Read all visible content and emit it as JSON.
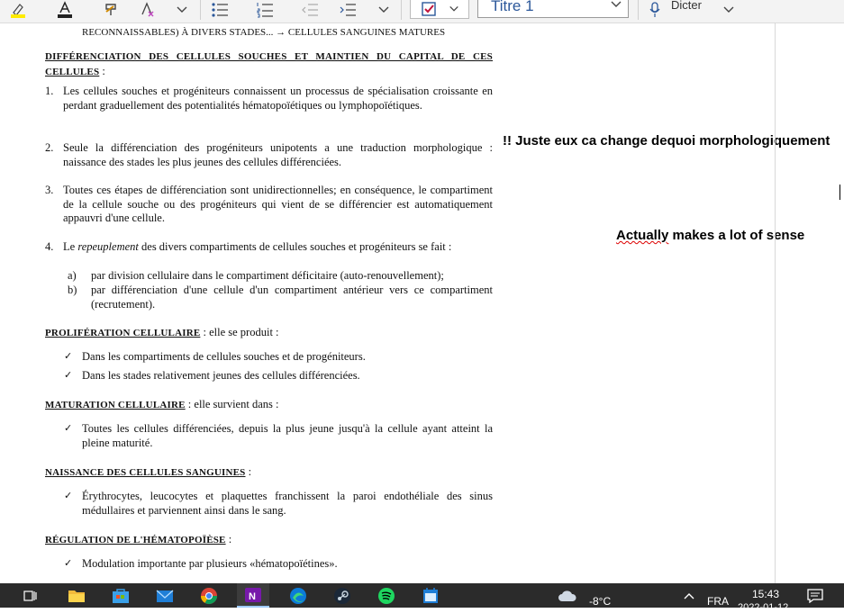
{
  "ribbon": {
    "style_value": "Titre 1",
    "dictate_label": "Dicter",
    "icons": [
      "highlighter-icon",
      "font-color-icon",
      "format-painter-icon",
      "clear-format-icon",
      "chevron-down-icon",
      "bullet-list-icon",
      "numbered-list-icon",
      "outdent-icon",
      "indent-icon",
      "chevron-down-icon",
      "todo-tag-icon",
      "chevron-down-icon",
      "microphone-icon"
    ]
  },
  "doc": {
    "top_fragment": "RECONNAISSABLES) À DIVERS STADES... → CELLULES SANGUINES MATURES",
    "diff_heading": "DIFFÉRENCIATION DES CELLULES SOUCHES ET MAINTIEN DU CAPITAL DE CES CELLULES",
    "diff_heading_suffix": " :",
    "items": [
      {
        "num": "1.",
        "text": "Les cellules souches  et progéniteurs connaissent un processus de spécialisation croissante en perdant graduellement des potentialités hématopoïétiques ou lymphopoïétiques."
      },
      {
        "num": "2.",
        "text": "Seule la différenciation des progéniteurs unipotents a une traduction morphologique : naissance des stades les plus jeunes des cellules différenciées."
      },
      {
        "num": "3.",
        "text": "Toutes ces étapes de différenciation sont unidirectionnelles; en conséquence, le compartiment de la cellule souche ou des progéniteurs qui vient de se différencier est automatiquement appauvri d'une cellule."
      },
      {
        "num": "4.",
        "text_before": "Le ",
        "text_italic": "repeuplement",
        "text_after": " des divers compartiments de cellules souches et progéniteurs se fait :"
      }
    ],
    "subitems": [
      {
        "label": "a)",
        "text": "par division cellulaire dans le compartiment déficitaire (auto-renouvellement);"
      },
      {
        "label": "b)",
        "text": "par différenciation d'une cellule d'un compartiment antérieur vers ce compartiment (recrutement)."
      }
    ],
    "prolif_heading": "PROLIFÉRATION CELLULAIRE",
    "prolif_suffix": " : elle se produit :",
    "prolif_items": [
      "Dans les compartiments de cellules souches et de progéniteurs.",
      "Dans les stades relativement jeunes des cellules différenciées."
    ],
    "matur_heading": "MATURATION CELLULAIRE",
    "matur_suffix": " : elle survient dans :",
    "matur_items": [
      "Toutes les cellules différenciées, depuis la plus jeune jusqu'à la cellule ayant atteint la pleine maturité."
    ],
    "naiss_heading": "NAISSANCE DES CELLULES SANGUINES",
    "naiss_suffix": " :",
    "naiss_items": [
      "Érythrocytes, leucocytes et plaquettes franchissent la paroi endothéliale des sinus médullaires et parviennent ainsi dans le sang."
    ],
    "regul_heading": "RÉGULATION DE L'HÉMATOPOÏÈSE",
    "regul_suffix": " :",
    "regul_items": [
      "Modulation importante par plusieurs «hématopoïétines»."
    ],
    "check_mark": "✓"
  },
  "notes": {
    "note1": "!! Juste eux ca change dequoi morphologiquement",
    "note2_squiggled": "Actually",
    "note2_rest": " makes a lot of sense"
  },
  "taskbar": {
    "apps": [
      "task-view-icon",
      "file-explorer-icon",
      "store-icon",
      "mail-icon",
      "chrome-icon",
      "onenote-icon",
      "edge-icon",
      "steam-icon",
      "spotify-icon",
      "calendar-icon"
    ],
    "weather_temp": "-8°C",
    "language": "FRA",
    "time": "15:43",
    "date": "2022-01-12"
  },
  "colors": {
    "ribbon_bg": "#f3f3f3",
    "taskbar_bg": "#2b2b2b",
    "accent": "#2b579a",
    "onenote": "#7719aa"
  }
}
